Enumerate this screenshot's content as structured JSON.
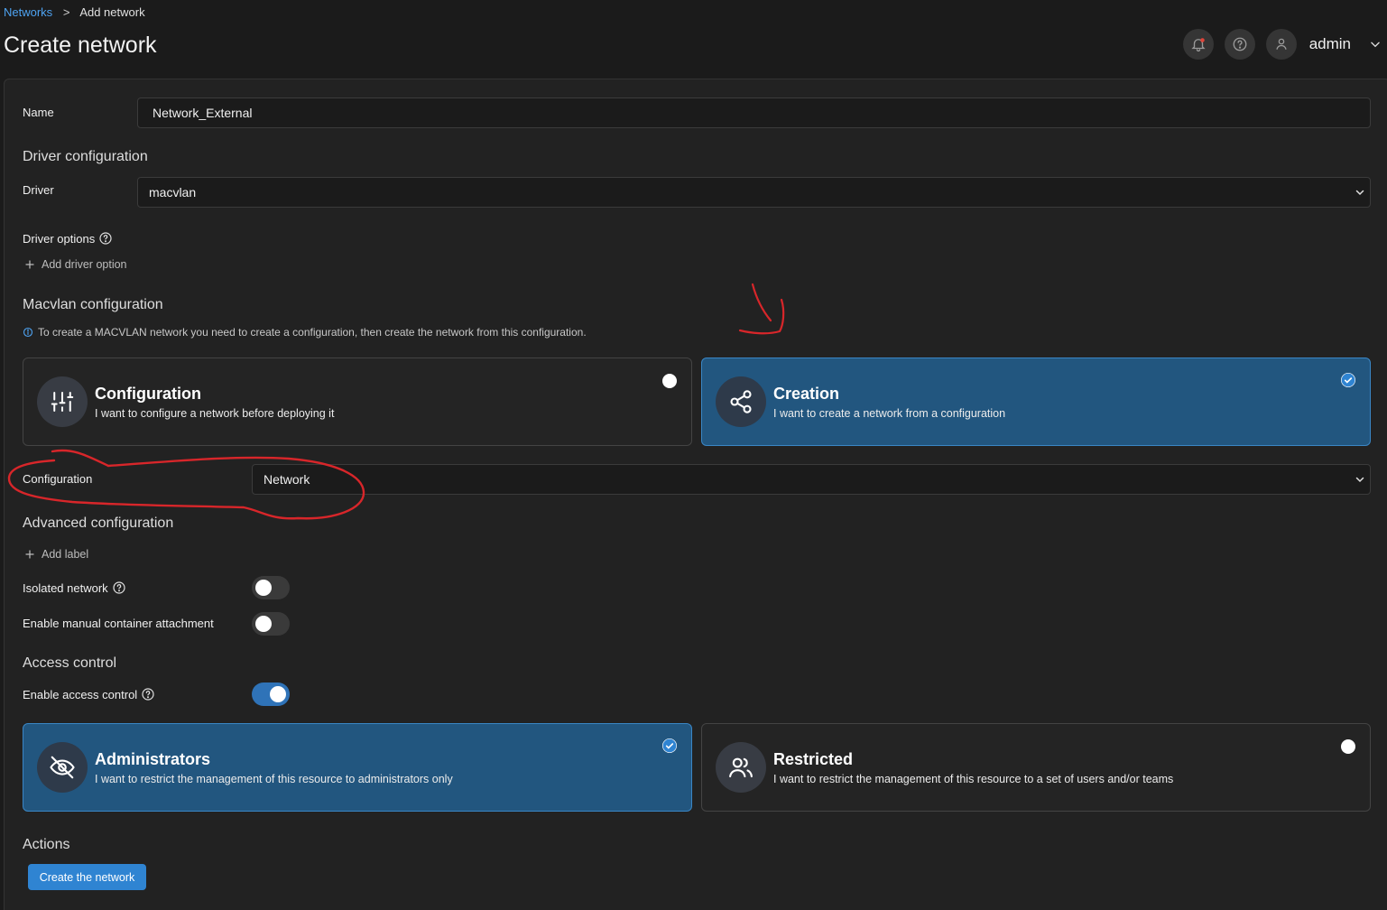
{
  "breadcrumb": {
    "parent": "Networks",
    "separator": ">",
    "current": "Add network"
  },
  "page_title": "Create network",
  "topbar": {
    "username": "admin"
  },
  "form": {
    "name_label": "Name",
    "name_value": "Network_External",
    "driver_section": "Driver configuration",
    "driver_label": "Driver",
    "driver_value": "macvlan",
    "driver_options_label": "Driver options",
    "add_driver_option": "Add driver option",
    "macvlan_section": "Macvlan configuration",
    "macvlan_info": "To create a MACVLAN network you need to create a configuration, then create the network from this configuration.",
    "mode_cards": [
      {
        "title": "Configuration",
        "desc": "I want to configure a network before deploying it",
        "selected": false
      },
      {
        "title": "Creation",
        "desc": "I want to create a network from a configuration",
        "selected": true
      }
    ],
    "configuration_label": "Configuration",
    "configuration_value": "Network",
    "advanced_section": "Advanced configuration",
    "add_label": "Add label",
    "isolated_label": "Isolated network",
    "isolated_on": false,
    "manual_attach_label": "Enable manual container attachment",
    "manual_attach_on": false,
    "access_section": "Access control",
    "access_label": "Enable access control",
    "access_on": true,
    "access_cards": [
      {
        "title": "Administrators",
        "desc": "I want to restrict the management of this resource to administrators only",
        "selected": true
      },
      {
        "title": "Restricted",
        "desc": "I want to restrict the management of this resource to a set of users and/or teams",
        "selected": false
      }
    ],
    "actions_section": "Actions",
    "submit_label": "Create the network"
  },
  "colors": {
    "accent": "#2f84d2",
    "selected_card": "#22567f",
    "annotation": "#d8262a"
  }
}
